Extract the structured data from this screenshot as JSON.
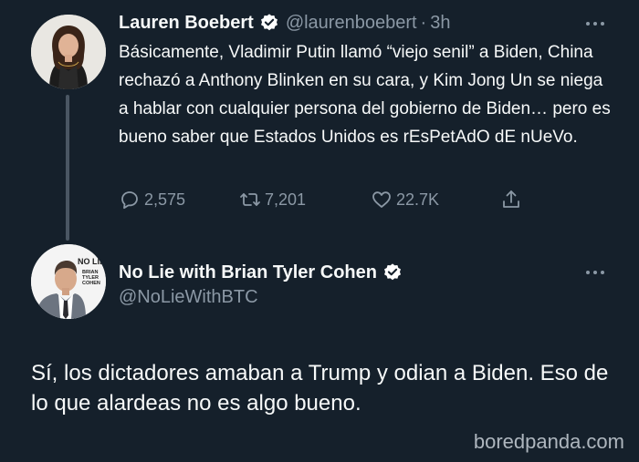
{
  "tweet1": {
    "author_name": "Lauren Boebert",
    "handle": "@laurenboebert",
    "separator": "·",
    "time": "3h",
    "text": "Básicamente, Vladimir Putin llamó “viejo senil” a Biden, China rechazó a Anthony Blinken en su cara, y Kim Jong Un se niega a hablar con cualquier persona del gobierno de Biden… pero es bueno saber que Estados Unidos es rEsPetAdO dE nUeVo.",
    "replies": "2,575",
    "retweets": "7,201",
    "likes": "22.7K",
    "icons": [
      "verified-badge-icon",
      "reply-icon",
      "retweet-icon",
      "like-icon",
      "share-icon",
      "more-icon"
    ]
  },
  "tweet2": {
    "author_name": "No Lie with Brian Tyler Cohen",
    "handle": "@NoLieWithBTC",
    "avatar_text_top": "NO LIE",
    "avatar_text_brand": "BRIAN TYLER COHEN",
    "text": "Sí, los dictadores amaban a Trump y odian a Biden. Eso de lo que alardeas no es algo bueno.",
    "icons": [
      "verified-badge-icon",
      "more-icon"
    ]
  },
  "watermark": "boredpanda.com",
  "colors": {
    "background": "#15202b",
    "primary_text": "#f7f9f9",
    "secondary_text": "#8b98a5",
    "thread_line": "#4a5663",
    "verified_badge": "#ffffff"
  }
}
